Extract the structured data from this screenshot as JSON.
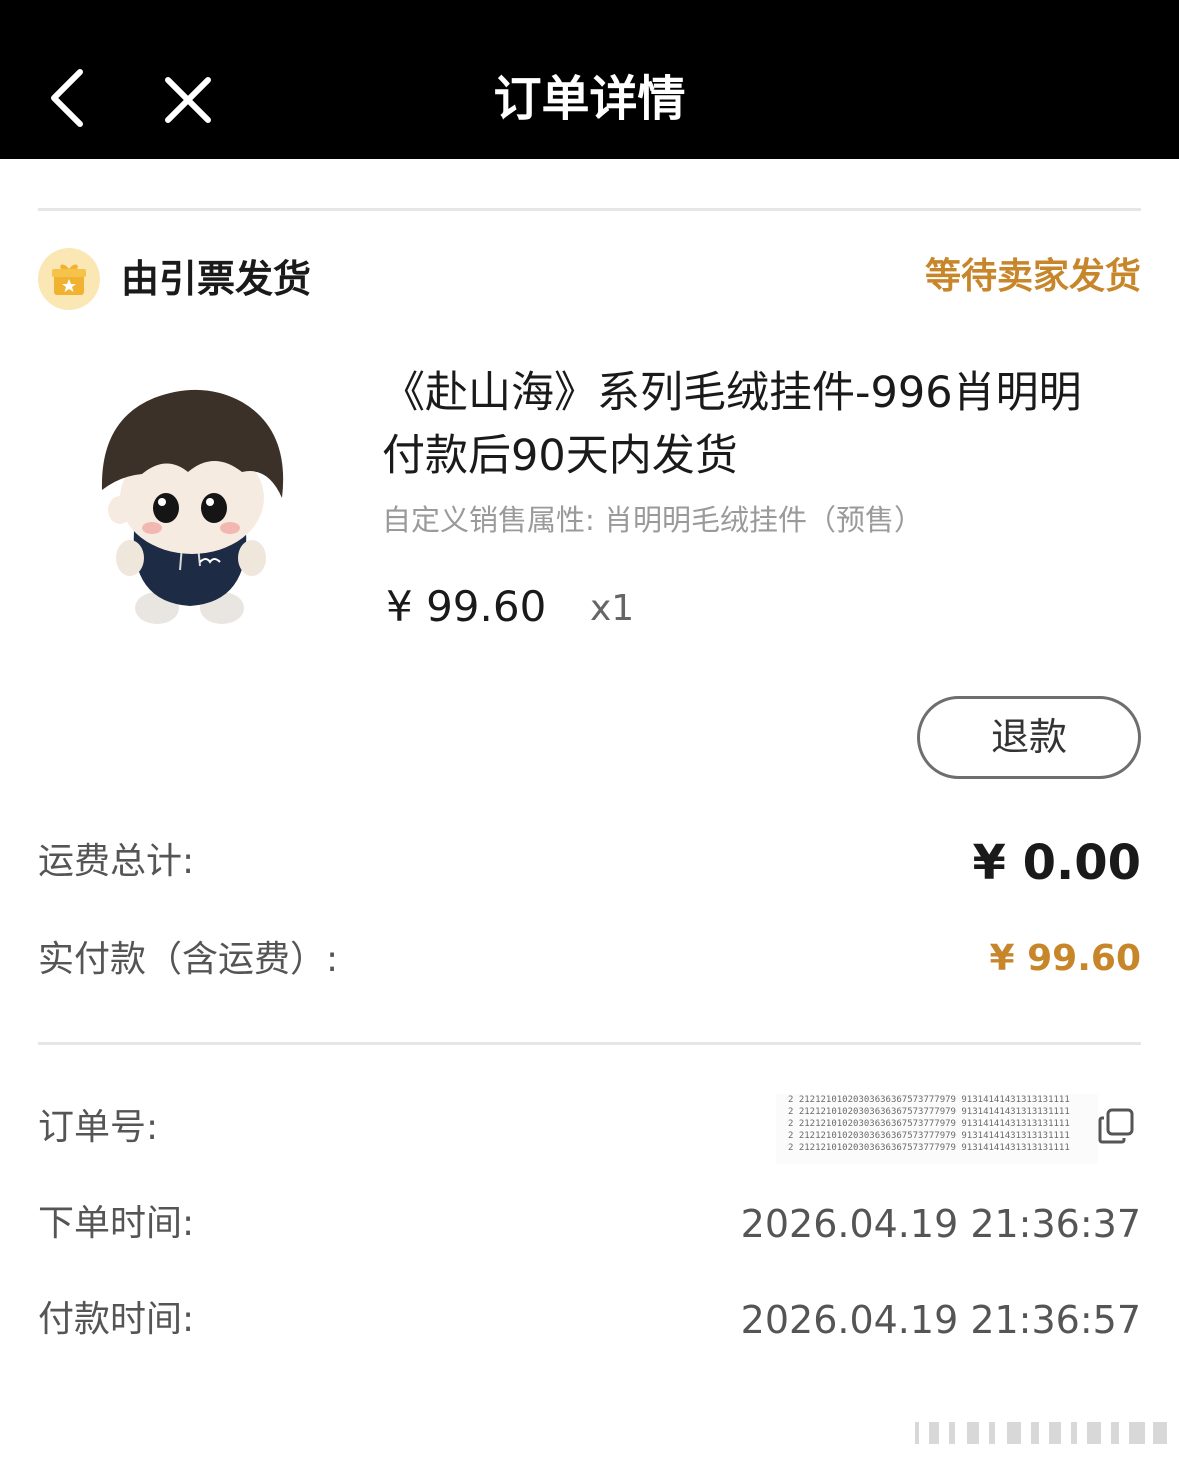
{
  "header": {
    "title": "订单详情",
    "back_icon": "chevron-left-icon",
    "close_icon": "close-icon"
  },
  "shop": {
    "name": "由引票发货",
    "icon": "gift-icon",
    "status": "等待卖家发货"
  },
  "product": {
    "image": "plush-doll-image",
    "title": "《赴山海》系列毛绒挂件-996肖明明",
    "shipping_note": "付款后90天内发货",
    "attribute": "自定义销售属性: 肖明明毛绒挂件（预售）",
    "price": "¥ 99.60",
    "quantity": "x1"
  },
  "actions": {
    "refund_label": "退款"
  },
  "summary": {
    "shipping_label": "运费总计:",
    "shipping_value": "¥ 0.00",
    "paid_label": "实付款（含运费）:",
    "paid_value": "¥ 99.60"
  },
  "info": {
    "order_number_label": "订单号:",
    "order_number_lines": [
      "2  21212101020303636367573777979 91314141431313131111",
      "2  21212101020303636367573777979 91314141431313131111",
      "2  21212101020303636367573777979 91314141431313131111",
      "2  21212101020303636367573777979 91314141431313131111",
      "2  21212101020303636367573777979 91314141431313131111"
    ],
    "order_time_label": "下单时间:",
    "order_time_value": "2026.04.19 21:36:37",
    "pay_time_label": "付款时间:",
    "pay_time_value": "2026.04.19 21:36:57"
  },
  "colors": {
    "accent": "#c8862b",
    "header_bg": "#000000",
    "badge_bg": "#fbe7b4"
  }
}
